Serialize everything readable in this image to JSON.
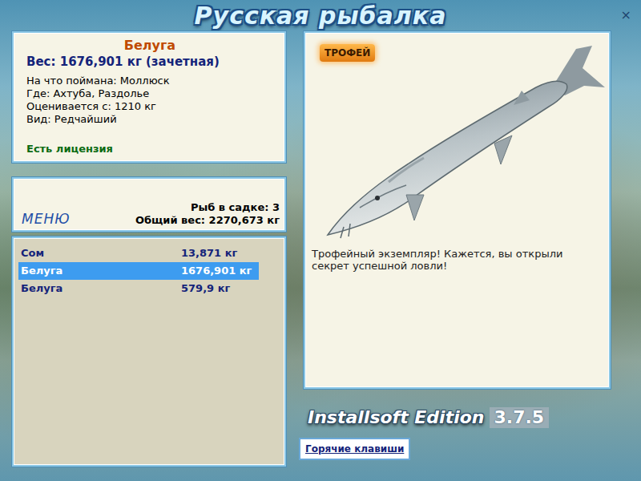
{
  "window": {
    "title": "Русская рыбалка",
    "close": "×"
  },
  "fish_info": {
    "name": "Белуга",
    "weight": "Вес: 1676,901 кг (зачетная)",
    "details": [
      "На что поймана: Моллюск",
      "Где: Ахтуба, Раздолье",
      "Оценивается с: 1210 кг",
      "Вид: Редчайший"
    ],
    "license": "Есть лицензия"
  },
  "menu": {
    "label": "МЕНЮ"
  },
  "keepnet": {
    "count": "Рыб в садке: 3",
    "total": "Общий вес: 2270,673 кг"
  },
  "catch_list": [
    {
      "name": "Сом",
      "weight": "13,871 кг",
      "selected": false
    },
    {
      "name": "Белуга",
      "weight": "1676,901 кг",
      "selected": true
    },
    {
      "name": "Белуга",
      "weight": "579,9 кг",
      "selected": false
    }
  ],
  "trophy": {
    "badge": "ТРОФЕЙ",
    "message": "Трофейный экземпляр! Кажется, вы открыли секрет успешной ловли!"
  },
  "edition": {
    "label": "Installsoft Edition",
    "version": "3.7.5"
  },
  "hotkeys_button": "Горячие клавиши"
}
